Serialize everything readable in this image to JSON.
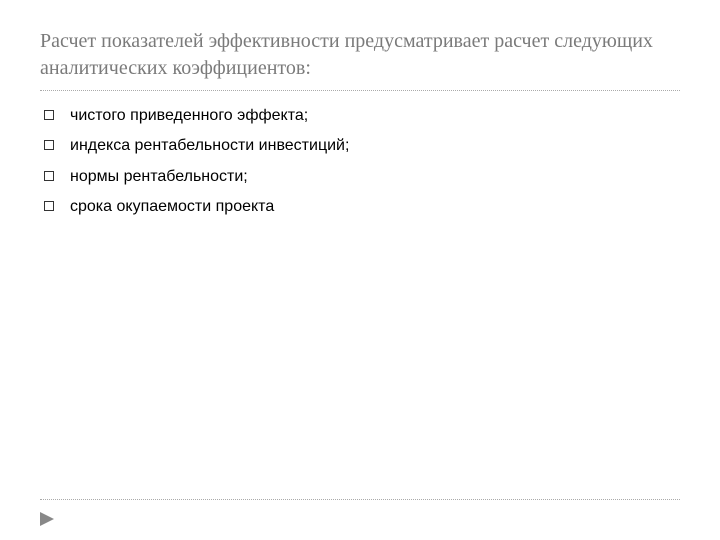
{
  "title": "Расчет показателей эффективности предусматривает расчет следующих аналитических коэффициентов:",
  "items": [
    "чистого приведенного эффекта;",
    "индекса рентабельности инвестиций;",
    "нормы рентабельности;",
    "срока окупаемости проекта"
  ]
}
